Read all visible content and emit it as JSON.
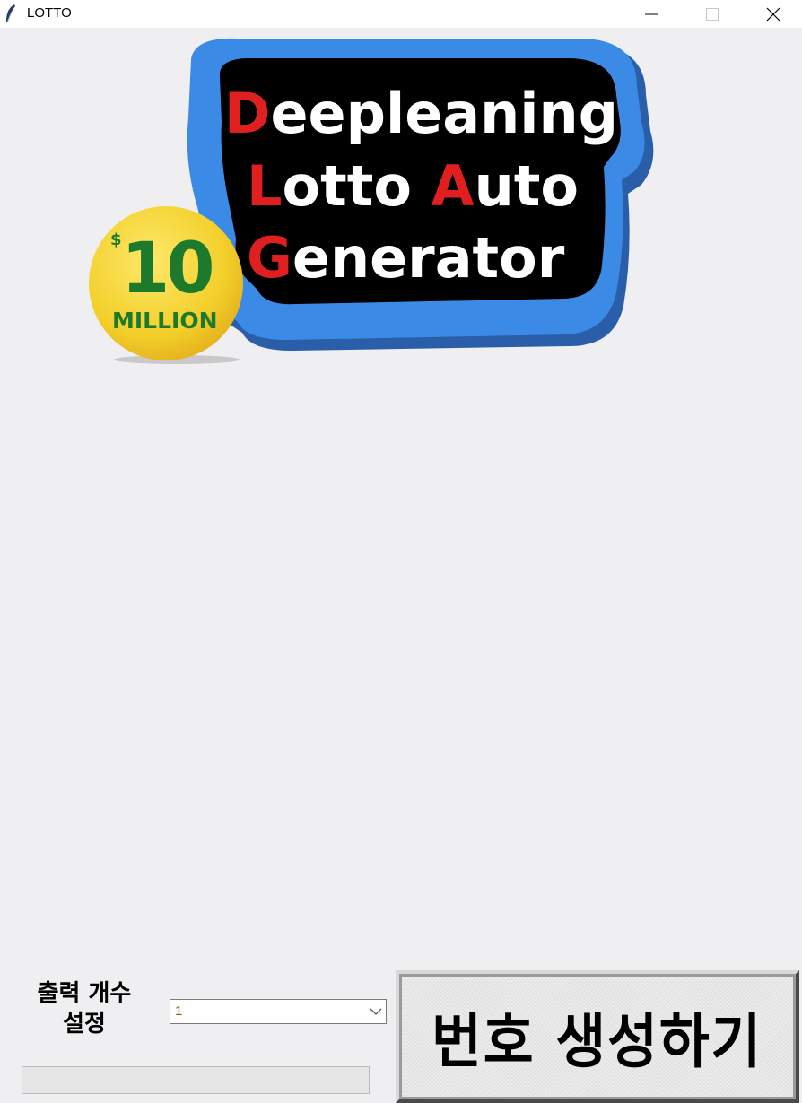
{
  "window": {
    "title": "LOTTO",
    "icon": "feather-icon",
    "controls": [
      "minimize-icon",
      "maximize-icon",
      "close-icon"
    ]
  },
  "logo": {
    "line1": {
      "first": "D",
      "rest": "eepleaning"
    },
    "line2": {
      "first": "L",
      "middle": "otto ",
      "highlight": "A",
      "rest": "uto"
    },
    "line3": {
      "first": "G",
      "rest": "enerator"
    },
    "badge_currency": "$",
    "badge_amount": "10",
    "badge_unit": "MILLION"
  },
  "controls": {
    "count_label_line1": "출력 개수",
    "count_label_line2": "설정",
    "count_value": "1",
    "generate_label": "번호 생성하기"
  },
  "colors": {
    "accent_red": "#e02020",
    "badge_yellow": "#f3cf2a",
    "badge_green": "#1d7a2c",
    "logo_blue": "#2f7fe0"
  }
}
